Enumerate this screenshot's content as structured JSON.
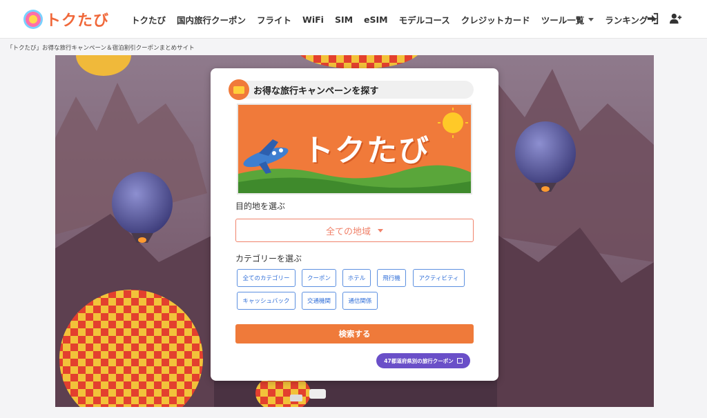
{
  "header": {
    "logo_text": "トクたび",
    "nav": [
      {
        "label": "トクたび",
        "dropdown": false
      },
      {
        "label": "国内旅行クーポン",
        "dropdown": false
      },
      {
        "label": "フライト",
        "dropdown": false
      },
      {
        "label": "WiFi",
        "dropdown": false
      },
      {
        "label": "SIM",
        "dropdown": false
      },
      {
        "label": "eSIM",
        "dropdown": false
      },
      {
        "label": "モデルコース",
        "dropdown": false
      },
      {
        "label": "クレジットカード",
        "dropdown": false
      },
      {
        "label": "ツール一覧",
        "dropdown": true
      },
      {
        "label": "ランキング",
        "dropdown": true
      }
    ],
    "icons": [
      "sign-in-icon",
      "user-plus-icon"
    ]
  },
  "breadcrumb": "「トクたび」お得な旅行キャンペーン＆宿泊割引クーポンまとめサイト",
  "card": {
    "title": "お得な旅行キャンペーンを探す",
    "banner_text": "トクたび",
    "destination_label": "目的地を選ぶ",
    "region_value": "全ての地域",
    "category_label": "カテゴリーを選ぶ",
    "categories": [
      "全てのカテゴリー",
      "クーポン",
      "ホテル",
      "飛行機",
      "アクティビティ",
      "キャッシュバック",
      "交通機関",
      "通信関係"
    ],
    "search_button": "検索する",
    "prefecture_link": "47都道府県別の旅行クーポン"
  },
  "colors": {
    "accent_orange": "#ef7a3a",
    "chip_blue": "#2f6ed8",
    "link_purple": "#6a4fc8",
    "select_coral": "#f0826a"
  }
}
